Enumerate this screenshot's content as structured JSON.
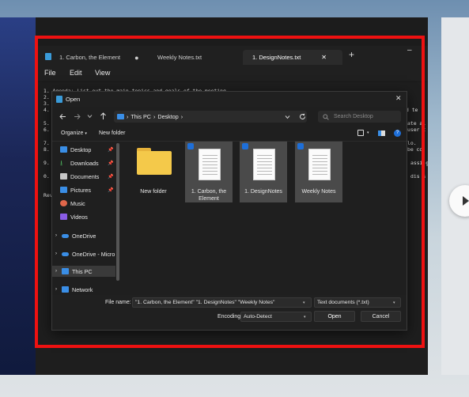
{
  "editor_app": {
    "tabs": [
      {
        "label": "1. Carbon, the Element"
      },
      {
        "label": "Weekly Notes.txt"
      },
      {
        "label": "1. DesignNotes.txt"
      }
    ],
    "new_tab_symbol": "+",
    "minimize_symbol": "–",
    "close_tab_symbol": "✕",
    "menu": [
      "File",
      "Edit",
      "View"
    ],
    "editor_lines": [
      "1. Agenda: List out the main topics and goals of the meeting.",
      "2.",
      "3.",
      "4.",
      "5.",
      "6.",
      "7.",
      "8.",
      "9.",
      "0.",
      "Rev"
    ],
    "right_fragments": [
      "d te r",
      "ate al",
      "user t",
      "lo.",
      "be co",
      "assi g",
      "dis s"
    ]
  },
  "dialog": {
    "title": "Open",
    "close_symbol": "✕",
    "breadcrumb": [
      "This PC",
      "Desktop"
    ],
    "breadcrumb_sep": "›",
    "search_placeholder": "Search Desktop",
    "organize_label": "Organize",
    "new_folder_label": "New folder",
    "nav_items": [
      {
        "label": "Desktop",
        "pinned": true,
        "color": "#3a8ee6"
      },
      {
        "label": "Downloads",
        "pinned": true,
        "color": "#4cb35e"
      },
      {
        "label": "Documents",
        "pinned": true,
        "color": "#c7c7c7"
      },
      {
        "label": "Pictures",
        "pinned": true,
        "color": "#3a8ee6"
      },
      {
        "label": "Music",
        "pinned": false,
        "color": "#e0664a"
      },
      {
        "label": "Videos",
        "pinned": false,
        "color": "#8a5ce6"
      },
      {
        "label": "OneDrive",
        "pinned": false,
        "color": "#3a8ee6"
      },
      {
        "label": "OneDrive - Micro",
        "pinned": false,
        "color": "#3a8ee6"
      },
      {
        "label": "This PC",
        "pinned": false,
        "color": "#3a8ee6"
      },
      {
        "label": "Network",
        "pinned": false,
        "color": "#3a8ee6"
      }
    ],
    "pin_symbol": "📌",
    "files": [
      {
        "label": "New folder",
        "type": "folder",
        "selected": false
      },
      {
        "label": "1. Carbon, the Element",
        "type": "text",
        "selected": true
      },
      {
        "label": "1. DesignNotes",
        "type": "text",
        "selected": true
      },
      {
        "label": "Weekly Notes",
        "type": "text",
        "selected": true
      }
    ],
    "file_name_label": "File name:",
    "file_name_value": "\"1. Carbon, the Element\" \"1. DesignNotes\" \"Weekly Notes\"",
    "file_type_value": "Text documents (*.txt)",
    "encoding_label": "Encoding:",
    "encoding_value": "Auto-Detect",
    "open_label": "Open",
    "cancel_label": "Cancel"
  },
  "colors": {
    "highlight_frame": "#ee1111",
    "accent": "#1e6fd9"
  }
}
